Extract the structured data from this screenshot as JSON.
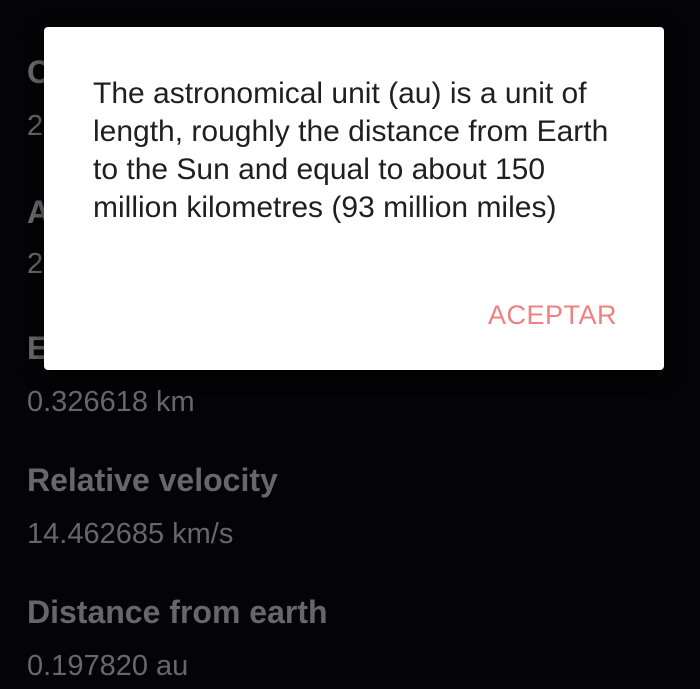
{
  "background_fields": [
    {
      "label": "C",
      "value": "2"
    },
    {
      "label": "A",
      "value": "2"
    },
    {
      "label": "E",
      "value": "0.326618 km"
    },
    {
      "label": "Relative velocity",
      "value": "14.462685 km/s"
    },
    {
      "label": "Distance from earth",
      "value": "0.197820 au"
    }
  ],
  "dialog": {
    "message": "The astronomical unit (au) is a unit of length, roughly the distance from Earth to the Sun and equal to about 150 million kilometres (93 million miles)",
    "button_label": "ACEPTAR"
  },
  "colors": {
    "background": "#060609",
    "field_text": "#8a8a8f",
    "dialog_background": "#ffffff",
    "dialog_text": "#1f1f1f",
    "accent": "#f08080"
  }
}
